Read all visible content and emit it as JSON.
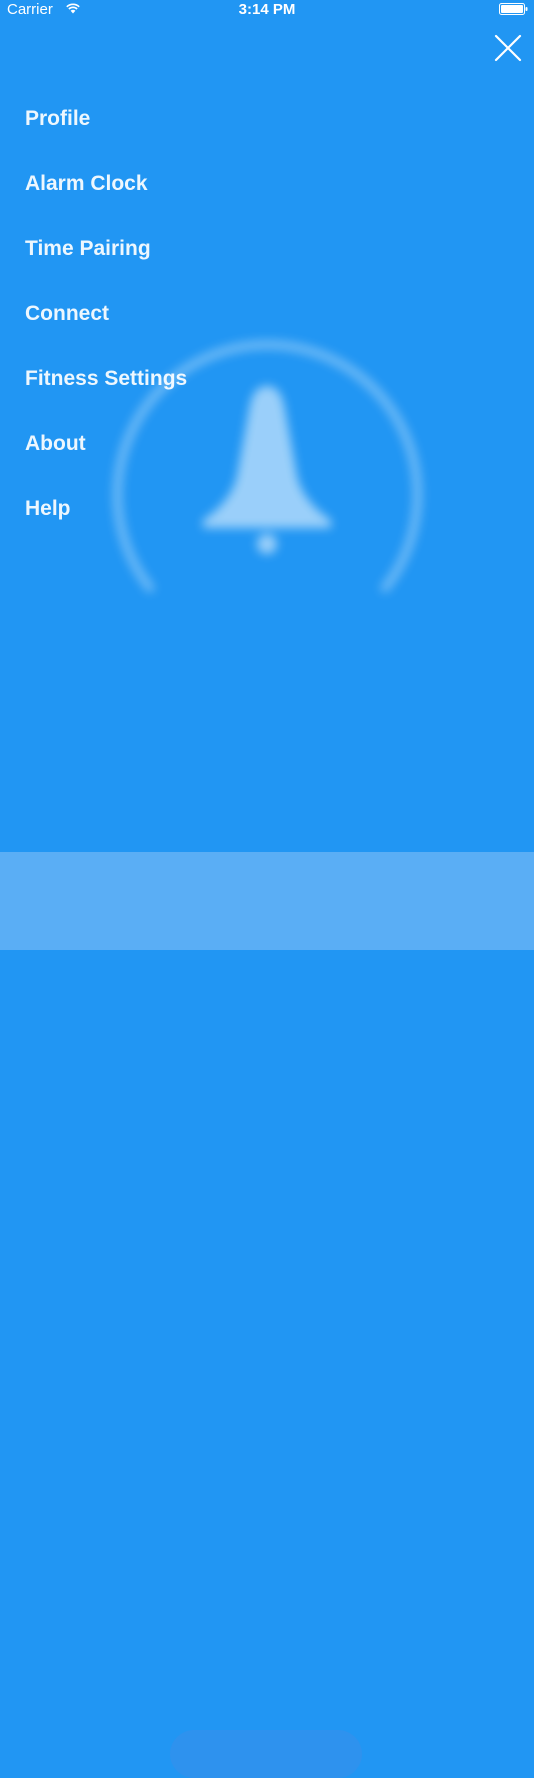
{
  "status_bar": {
    "carrier": "Carrier",
    "time": "3:14 PM",
    "icons": [
      "wifi-icon",
      "battery-icon"
    ]
  },
  "close_icon": "close-icon",
  "menu": {
    "items": [
      {
        "label": "Profile"
      },
      {
        "label": "Alarm Clock"
      },
      {
        "label": "Time Pairing"
      },
      {
        "label": "Connect"
      },
      {
        "label": "Fitness Settings"
      },
      {
        "label": "About"
      },
      {
        "label": "Help"
      }
    ]
  },
  "background": {
    "icon": "bell-icon",
    "status_text": "",
    "small_text": "",
    "button_label": ""
  },
  "colors": {
    "background": "#2196F3",
    "bottom_band": "#5AAEF5",
    "text": "#FFFFFF"
  }
}
